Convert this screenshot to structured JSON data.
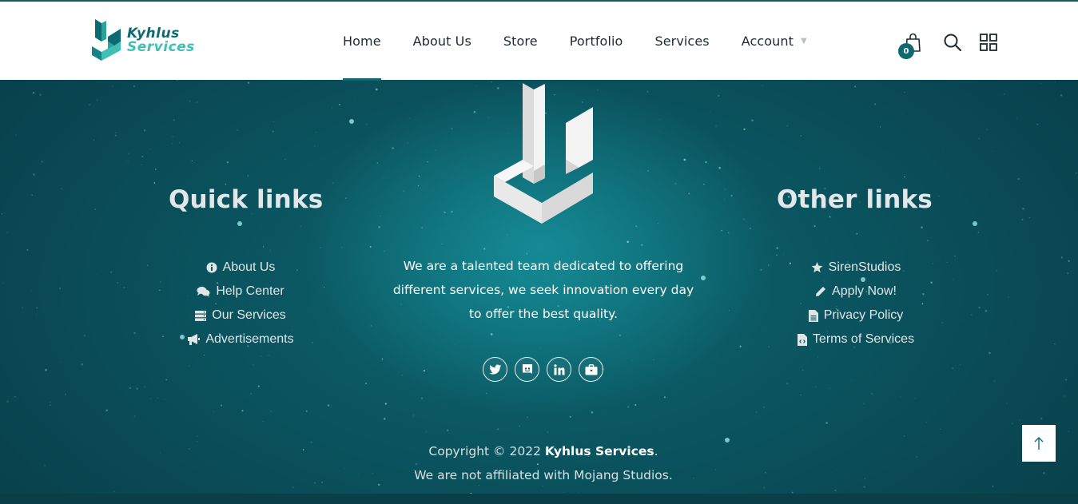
{
  "brand": {
    "line1": "Kyhlus",
    "line2": "Services"
  },
  "nav": {
    "items": [
      {
        "label": "Home"
      },
      {
        "label": "About Us"
      },
      {
        "label": "Store"
      },
      {
        "label": "Portfolio"
      },
      {
        "label": "Services"
      },
      {
        "label": "Account"
      }
    ]
  },
  "cart": {
    "count": "0"
  },
  "quick_links": {
    "title": "Quick links",
    "items": [
      {
        "label": "About Us",
        "icon": "info-icon"
      },
      {
        "label": "Help Center",
        "icon": "comments-icon"
      },
      {
        "label": "Our Services",
        "icon": "server-icon"
      },
      {
        "label": "Advertisements",
        "icon": "bullhorn-icon"
      }
    ]
  },
  "about": {
    "lines": [
      "We are a talented team dedicated to offering",
      "different services, we seek innovation every day",
      "to offer the best quality."
    ]
  },
  "socials": [
    {
      "icon": "twitter-icon"
    },
    {
      "icon": "discord-icon"
    },
    {
      "icon": "linkedin-icon"
    },
    {
      "icon": "briefcase-icon"
    }
  ],
  "other_links": {
    "title": "Other links",
    "items": [
      {
        "label": "SirenStudios",
        "icon": "star-icon"
      },
      {
        "label": "Apply Now!",
        "icon": "pencil-icon"
      },
      {
        "label": "Privacy Policy",
        "icon": "file-icon"
      },
      {
        "label": "Terms of Services",
        "icon": "file-code-icon"
      }
    ]
  },
  "copyright": {
    "prefix": "Copyright © 2022 ",
    "brand": "Kyhlus Services",
    "suffix": ".",
    "line2": "We are not affiliated with Mojang Studios."
  },
  "colors": {
    "accent": "#0e6a72",
    "accent_light": "#3ec1b4",
    "footer_bg": "#0a4d58"
  }
}
